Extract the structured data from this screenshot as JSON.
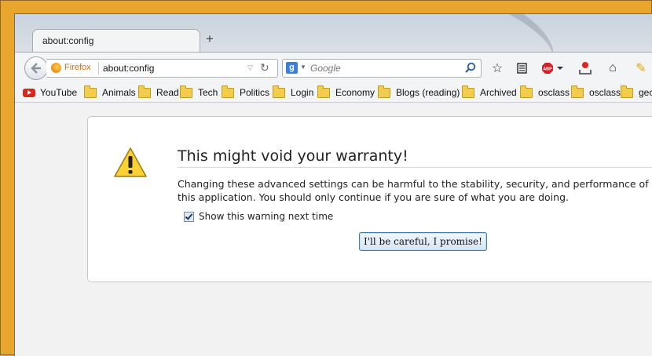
{
  "tab": {
    "title": "about:config",
    "new_tab_symbol": "+"
  },
  "urlbar": {
    "identity_label": "Firefox",
    "url": "about:config"
  },
  "searchbar": {
    "engine_letter": "g",
    "placeholder": "Google"
  },
  "bookmarks": [
    {
      "label": "YouTube",
      "icon": "youtube-icon"
    },
    {
      "label": "Animals",
      "icon": "folder-icon"
    },
    {
      "label": "Read",
      "icon": "folder-icon"
    },
    {
      "label": "Tech",
      "icon": "folder-icon"
    },
    {
      "label": "Politics",
      "icon": "folder-icon"
    },
    {
      "label": "Login",
      "icon": "folder-icon"
    },
    {
      "label": "Economy",
      "icon": "folder-icon"
    },
    {
      "label": "Blogs (reading)",
      "icon": "folder-icon"
    },
    {
      "label": "Archived",
      "icon": "folder-icon"
    },
    {
      "label": "osclass",
      "icon": "folder-icon"
    },
    {
      "label": "osclass",
      "icon": "folder-icon"
    },
    {
      "label": "gec",
      "icon": "folder-icon"
    }
  ],
  "warning": {
    "title": "This might void your warranty!",
    "body": "Changing these advanced settings can be harmful to the stability, security, and performance of this application. You should only continue if you are sure of what you are doing.",
    "checkbox_label": "Show this warning next time",
    "checkbox_checked": true,
    "button_label": "I'll be careful, I promise!"
  },
  "colors": {
    "desktop": "#e9a62c",
    "firefox_orange": "#e36c0a",
    "button_border": "#3c7fb1"
  }
}
